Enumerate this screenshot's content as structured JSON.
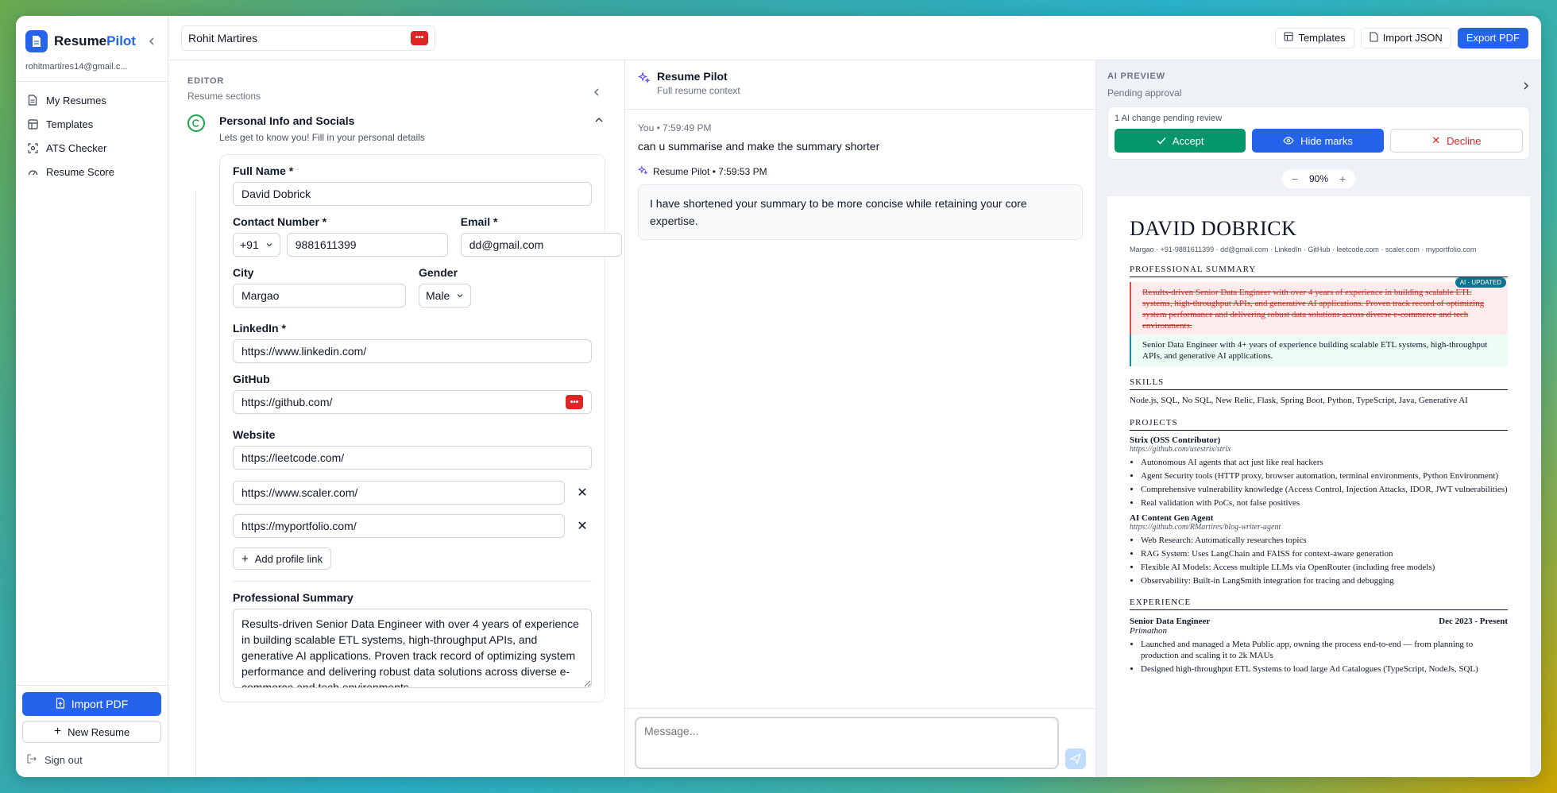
{
  "sidebar": {
    "brand_resume": "Resume",
    "brand_pilot": "Pilot",
    "email": "rohitmartires14@gmail.c...",
    "nav": [
      {
        "label": "My Resumes",
        "icon": "document-icon"
      },
      {
        "label": "Templates",
        "icon": "layout-icon"
      },
      {
        "label": "ATS Checker",
        "icon": "scan-icon"
      },
      {
        "label": "Resume Score",
        "icon": "gauge-icon"
      }
    ],
    "import_pdf": "Import PDF",
    "new_resume": "New Resume",
    "sign_out": "Sign out"
  },
  "topbar": {
    "resume_title": "Rohit Martires",
    "templates": "Templates",
    "import_json": "Import JSON",
    "export_pdf": "Export PDF"
  },
  "editor": {
    "label": "EDITOR",
    "sub": "Resume sections",
    "section_title": "Personal Info and Socials",
    "section_desc": "Lets get to know you! Fill in your personal details",
    "full_name_label": "Full Name *",
    "full_name": "David Dobrick",
    "contact_label": "Contact Number *",
    "country_code": "+91",
    "phone": "9881611399",
    "email_label": "Email *",
    "email": "dd@gmail.com",
    "city_label": "City",
    "city": "Margao",
    "gender_label": "Gender",
    "gender": "Male",
    "linkedin_label": "LinkedIn *",
    "linkedin": "https://www.linkedin.com/",
    "github_label": "GitHub",
    "github": "https://github.com/",
    "website_label": "Website",
    "website": "https://leetcode.com/",
    "extra_links": [
      "https://www.scaler.com/",
      "https://myportfolio.com/"
    ],
    "add_link": "Add profile link",
    "summary_label": "Professional Summary",
    "summary": "Results-driven Senior Data Engineer with over 4 years of experience in building scalable ETL systems, high-throughput APIs, and generative AI applications. Proven track record of optimizing system performance and delivering robust data solutions across diverse e-commerce and tech environments."
  },
  "chat": {
    "title": "Resume Pilot",
    "sub": "Full resume context",
    "user_meta": "You • 7:59:49 PM",
    "user_msg": "can u summarise and make the summary shorter",
    "bot_meta": "Resume Pilot • 7:59:53 PM",
    "bot_msg": "I have shortened your summary to be more concise while retaining your core expertise.",
    "placeholder": "Message..."
  },
  "preview": {
    "label": "AI PREVIEW",
    "sub": "Pending approval",
    "pending": "1 AI change pending review",
    "accept": "Accept",
    "hide_marks": "Hide marks",
    "decline": "Decline",
    "zoom": "90%",
    "resume": {
      "name": "DAVID DOBRICK",
      "contact": "Margao · +91-9881611399 · dd@gmail.com · LinkedIn · GitHub · leetcode.com · scaler.com · myportfolio.com",
      "summary_heading": "PROFESSIONAL SUMMARY",
      "ai_badge": "AI · UPDATED",
      "summary_old": "Results-driven Senior Data Engineer with over 4 years of experience in building scalable ETL systems, high-throughput APIs, and generative AI applications. Proven track record of optimizing system performance and delivering robust data solutions across diverse e-commerce and tech environments.",
      "summary_new": "Senior Data Engineer with 4+ years of experience building scalable ETL systems, high-throughput APIs, and generative AI applications.",
      "skills_heading": "SKILLS",
      "skills": "Node.js, SQL, No SQL, New Relic, Flask, Spring Boot, Python, TypeScript, Java, Generative AI",
      "projects_heading": "PROJECTS",
      "projects": [
        {
          "title": "Strix (OSS Contributor)",
          "link": "https://github.com/usestrix/strix",
          "bullets": [
            "Autonomous AI agents that act just like real hackers",
            "Agent Security tools (HTTP proxy, browser automation, terminal environments, Python Environment)",
            "Comprehensive vulnerability knowledge (Access Control, Injection Attacks, IDOR, JWT vulnerabilities)",
            "Real validation with PoCs, not false positives"
          ]
        },
        {
          "title": "AI Content Gen Agent",
          "link": "https://github.com/RMartires/blog-writer-agent",
          "bullets": [
            "Web Research: Automatically researches topics",
            "RAG System: Uses LangChain and FAISS for context-aware generation",
            "Flexible AI Models: Access multiple LLMs via OpenRouter (including free models)",
            "Observability: Built-in LangSmith integration for tracing and debugging"
          ]
        }
      ],
      "experience_heading": "EXPERIENCE",
      "exp_role": "Senior Data Engineer",
      "exp_dates": "Dec 2023 - Present",
      "exp_company": "Primathon",
      "exp_bullets": [
        "Launched and managed a Meta Public app, owning the process end-to-end — from planning to production and scaling it to 2k MAUs",
        "Designed high-throughput ETL Systems to load large Ad Catalogues (TypeScript, NodeJs, SQL)"
      ]
    }
  },
  "colors": {
    "primary": "#2563eb",
    "accept": "#059669",
    "decline": "#dc2626"
  }
}
